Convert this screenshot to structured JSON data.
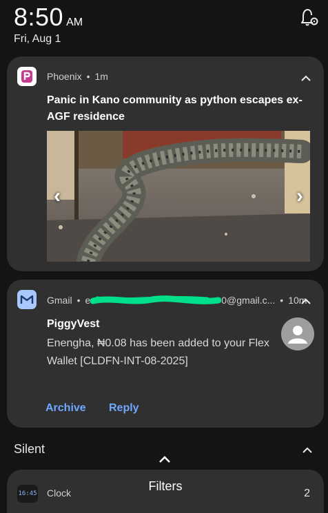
{
  "status": {
    "time": "8:50",
    "ampm": "AM",
    "date": "Fri, Aug 1"
  },
  "notifications": [
    {
      "app": "Phoenix",
      "age": "1m",
      "title": "Panic in Kano community as python escapes ex-AGF residence",
      "icon": "phoenix-logo-icon",
      "accent": "#d93d8c"
    },
    {
      "app": "Gmail",
      "account_prefix": "e",
      "account_suffix": "0@gmail.c...",
      "age": "10m",
      "sender": "PiggyVest",
      "body": "Enengha, ₦0.08 has been added to your Flex Wallet [CLDFN-INT-08-2025]",
      "actions": [
        "Archive",
        "Reply"
      ],
      "icon": "gmail-icon",
      "accent": "#6fa8ff"
    }
  ],
  "silent": {
    "label": "Silent",
    "clock_icon_time": "16:45",
    "clock_app": "Clock",
    "clock_count": "2",
    "filters_label": "Filters"
  },
  "carousel": {
    "prev": "‹",
    "next": "›"
  },
  "colors": {
    "background": "#141414",
    "card": "#303030",
    "link": "#6fa8ff",
    "scribble": "#00e08a"
  }
}
